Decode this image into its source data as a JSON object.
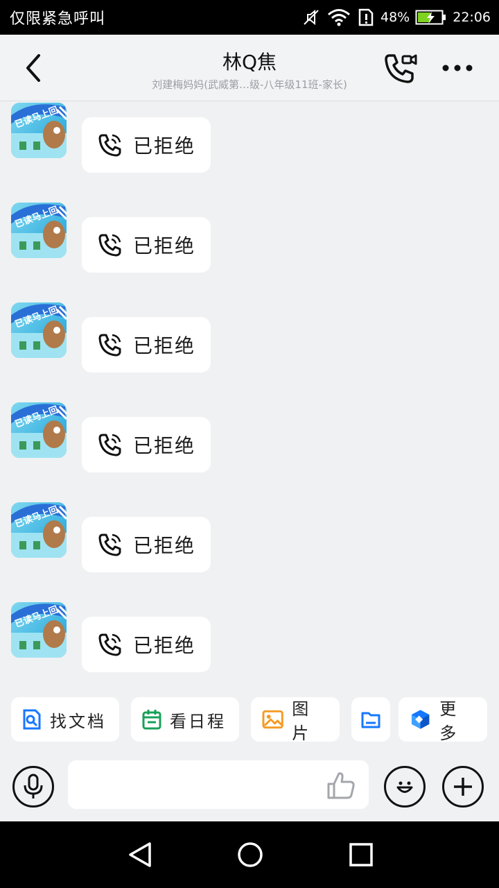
{
  "status_bar": {
    "carrier": "仅限紧急呼叫",
    "battery": "48%",
    "time": "22:06",
    "icons": [
      "mute-icon",
      "wifi-icon",
      "sim-alert-icon",
      "battery-charging-icon"
    ]
  },
  "header": {
    "title": "林Q焦",
    "subtitle": "刘建梅妈妈(武威第…级-八年级11班-家长)",
    "icons": [
      "back-arrow-icon",
      "voice-video-call-icon",
      "more-dots-icon"
    ]
  },
  "messages": [
    {
      "sticker_text": "已读马上回",
      "call_status": "已拒绝"
    },
    {
      "sticker_text": "已读马上回",
      "call_status": "已拒绝"
    },
    {
      "sticker_text": "已读马上回",
      "call_status": "已拒绝"
    },
    {
      "sticker_text": "已读马上回",
      "call_status": "已拒绝"
    },
    {
      "sticker_text": "已读马上回",
      "call_status": "已拒绝"
    },
    {
      "sticker_text": "已读马上回",
      "call_status": "已拒绝"
    }
  ],
  "quick_actions": [
    {
      "label": "找文档",
      "icon": "doc-search-icon",
      "color": "#1677ff"
    },
    {
      "label": "看日程",
      "icon": "calendar-icon",
      "color": "#18a058"
    },
    {
      "label": "图片",
      "icon": "image-icon",
      "color": "#f59a23"
    },
    {
      "label": "",
      "icon": "folder-icon",
      "color": "#1677ff"
    },
    {
      "label": "更多",
      "icon": "cube-more-icon",
      "color": "#1677ff"
    }
  ],
  "input_bar": {
    "placeholder": "",
    "icons": [
      "microphone-icon",
      "thumbs-up-icon",
      "emoji-icon",
      "plus-icon"
    ]
  },
  "nav_bar": {
    "icons": [
      "nav-back-icon",
      "nav-home-icon",
      "nav-recents-icon"
    ]
  }
}
